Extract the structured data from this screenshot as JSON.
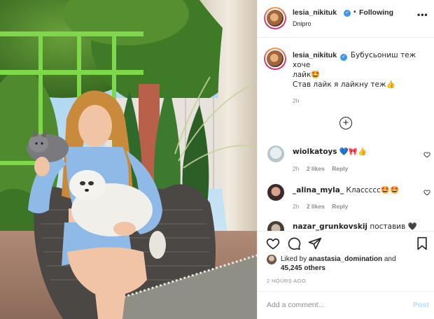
{
  "header": {
    "username": "lesia_nikituk",
    "separator": "•",
    "follow_state": "Following",
    "location": "Dnipro",
    "more_icon": "more-horizontal-icon"
  },
  "caption": {
    "username": "lesia_nikituk",
    "line1": "Бубусьониш теж хоче",
    "line2": "лайк🤩",
    "line3": "Став лайк я лайкну теж👍",
    "time": "2h"
  },
  "load_more_icon": "plus-circle-icon",
  "comments": [
    {
      "username": "wiolkatoys",
      "text": "💙🎀👍",
      "time": "2h",
      "likes": "2 likes",
      "reply": "Reply"
    },
    {
      "username": "_alina_myla_",
      "text": "Классссс🤩🤩",
      "time": "2h",
      "likes": "2 likes",
      "reply": "Reply"
    },
    {
      "username": "nazar_grunkovskij",
      "text": "поставив 🖤",
      "time": "",
      "likes": "",
      "reply": ""
    }
  ],
  "actions": {
    "like_icon": "heart-icon",
    "comment_icon": "comment-icon",
    "share_icon": "share-icon",
    "save_icon": "bookmark-icon"
  },
  "likes": {
    "prefix": "Liked by",
    "user": "anastasia_domination",
    "and": "and",
    "count": "45,245 others"
  },
  "time_ago": "2 HOURS AGO",
  "add_comment": {
    "placeholder": "Add a comment...",
    "post_label": "Post"
  },
  "colors": {
    "verified": "#3897f0",
    "muted": "#8e8e8e",
    "post_button": "#b2dffc",
    "text": "#262626"
  }
}
